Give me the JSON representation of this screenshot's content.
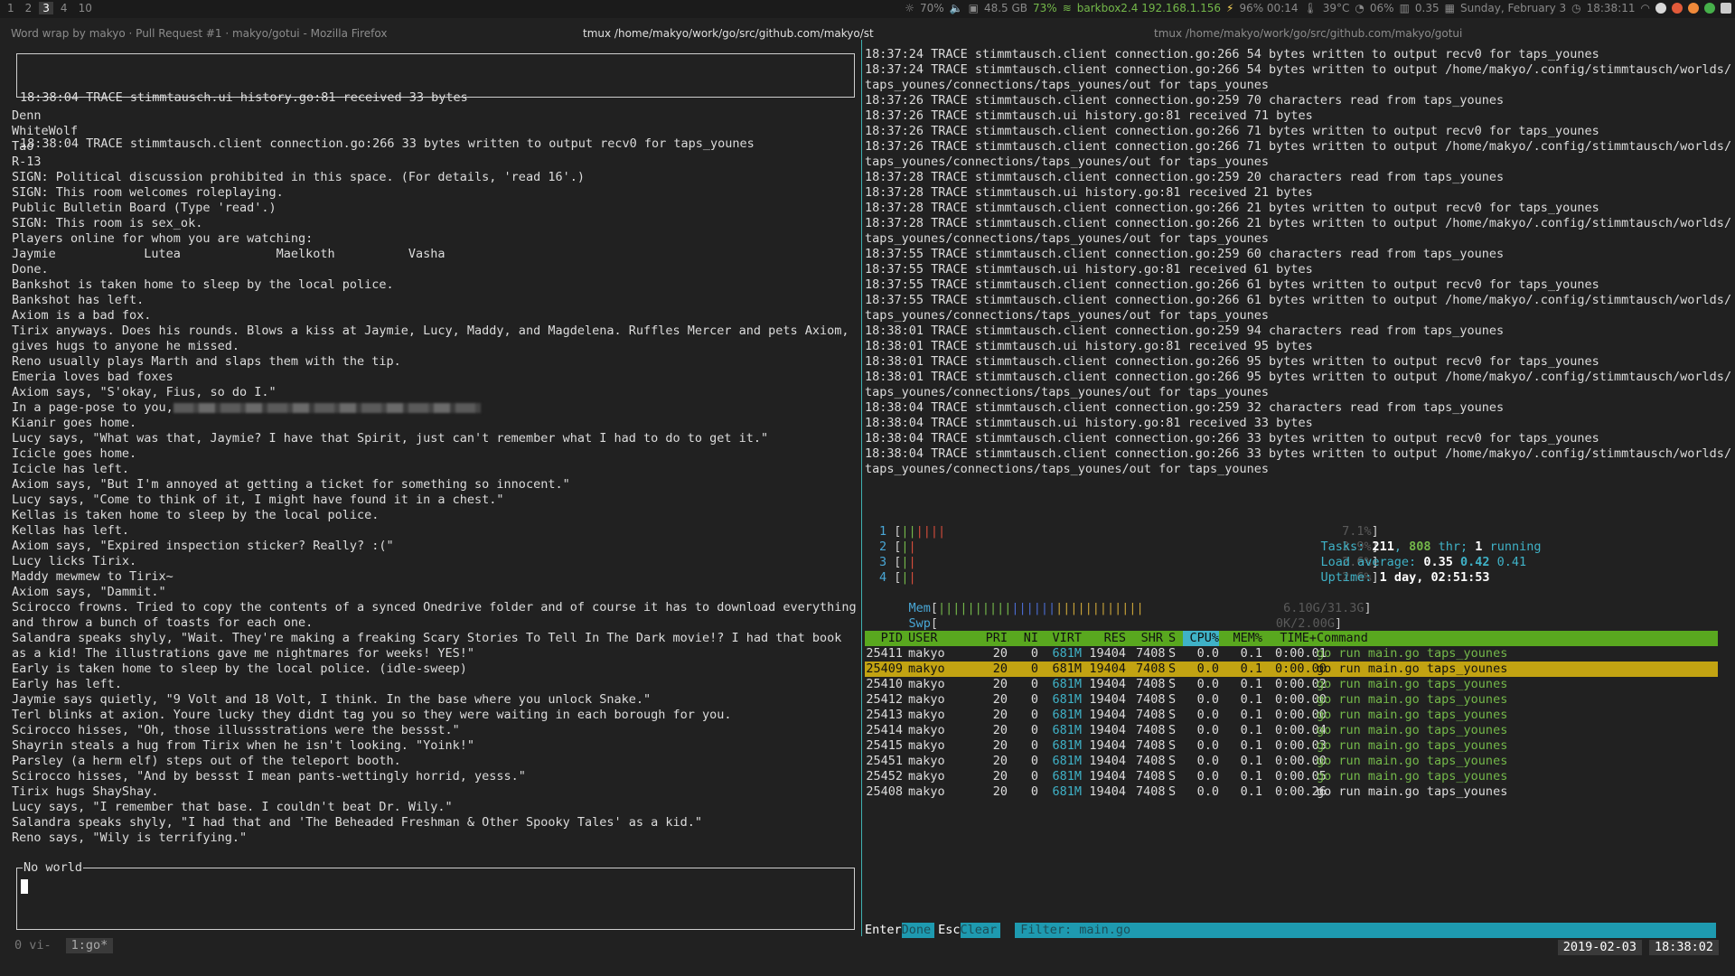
{
  "topbar": {
    "workspaces": [
      "1",
      "2",
      "3",
      "4",
      "10"
    ],
    "active_workspace": "3",
    "status": {
      "volume": "70%",
      "disk": "48.5 GB",
      "wifi_quality": "73%",
      "wifi_ssid": "barkbox2.4 192.168.1.156",
      "battery": "96% 00:14",
      "temp": "39°C",
      "cpu": "06%",
      "load": "0.35",
      "date": "Sunday, February  3",
      "time": "18:38:11"
    }
  },
  "titles": {
    "firefox": "Word wrap by makyo · Pull Request #1 · makyo/gotui - Mozilla Firefox",
    "center": "tmux  /home/makyo/work/go/src/github.com/makyo/st",
    "right": "tmux  /home/makyo/work/go/src/github.com/makyo/gotui"
  },
  "left": {
    "log_lines": [
      "18:38:04 TRACE stimmtausch.ui history.go:81 received 33 bytes",
      "18:38:04 TRACE stimmtausch.client connection.go:266 33 bytes written to output recv0 for taps_younes"
    ],
    "chat_lines": [
      "Denn",
      "WhiteWolf",
      "Tao",
      "R-13",
      "SIGN: Political discussion prohibited in this space. (For details, 'read 16'.)",
      "SIGN: This room welcomes roleplaying.",
      "Public Bulletin Board (Type 'read'.)",
      "SIGN: This room is sex_ok.",
      "Players online for whom you are watching:",
      "Jaymie            Lutea             Maelkoth          Vasha",
      "Done.",
      "Bankshot is taken home to sleep by the local police.",
      "Bankshot has left.",
      "Axiom is a bad fox.",
      "Tirix anyways. Does his rounds. Blows a kiss at Jaymie, Lucy, Maddy, and Magdelena. Ruffles Mercer and pets Axiom,",
      "gives hugs to anyone he missed.",
      "Reno usually plays Marth and slaps them with the tip.",
      "Emeria loves bad foxes",
      "Axiom says, \"S'okay, Fius, so do I.\"",
      "In a page-pose to you,",
      "Kianir goes home.",
      "Lucy says, \"What was that, Jaymie? I have that Spirit, just can't remember what I had to do to get it.\"",
      "Icicle goes home.",
      "Icicle has left.",
      "Axiom says, \"But I'm annoyed at getting a ticket for something so innocent.\"",
      "Lucy says, \"Come to think of it, I might have found it in a chest.\"",
      "Kellas is taken home to sleep by the local police.",
      "Kellas has left.",
      "Axiom says, \"Expired inspection sticker? Really? :(\"",
      "Lucy licks Tirix.",
      "Maddy mewmew to Tirix~",
      "Axiom says, \"Dammit.\"",
      "Scirocco frowns. Tried to copy the contents of a synced Onedrive folder and of course it has to download everything",
      "and throw a bunch of toasts for each one.",
      "Salandra speaks shyly, \"Wait. They're making a freaking Scary Stories To Tell In The Dark movie!? I had that book",
      "as a kid! The illustrations gave me nightmares for weeks! YES!\"",
      "Early is taken home to sleep by the local police. (idle-sweep)",
      "Early has left.",
      "Jaymie says quietly, \"9 Volt and 18 Volt, I think. In the base where you unlock Snake.\"",
      "Terl blinks at axion. Youre lucky they didnt tag you so they were waiting in each borough for you.",
      "Scirocco hisses, \"Oh, those illussstrations were the bessst.\"",
      "Shayrin steals a hug from Tirix when he isn't looking. \"Yoink!\"",
      "Parsley (a herm elf) steps out of the teleport booth.",
      "Scirocco hisses, \"And by bessst I mean pants-wettingly horrid, yesss.\"",
      "Tirix hugs ShayShay.",
      "Lucy says, \"I remember that base. I couldn't beat Dr. Wily.\"",
      "Salandra speaks shyly, \"I had that and 'The Beheaded Freshman & Other Spooky Tales' as a kid.\"",
      "Reno says, \"Wily is terrifying.\""
    ],
    "input_label": "No world",
    "tmux": {
      "win0": "0 vi-",
      "win1": "1:go*"
    }
  },
  "right": {
    "log_lines": [
      "18:37:24 TRACE stimmtausch.client connection.go:266 54 bytes written to output recv0 for taps_younes",
      "18:37:24 TRACE stimmtausch.client connection.go:266 54 bytes written to output /home/makyo/.config/stimmtausch/worlds/",
      "taps_younes/connections/taps_younes/out for taps_younes",
      "18:37:26 TRACE stimmtausch.client connection.go:259 70 characters read from taps_younes",
      "18:37:26 TRACE stimmtausch.ui history.go:81 received 71 bytes",
      "18:37:26 TRACE stimmtausch.client connection.go:266 71 bytes written to output recv0 for taps_younes",
      "18:37:26 TRACE stimmtausch.client connection.go:266 71 bytes written to output /home/makyo/.config/stimmtausch/worlds/",
      "taps_younes/connections/taps_younes/out for taps_younes",
      "18:37:28 TRACE stimmtausch.client connection.go:259 20 characters read from taps_younes",
      "18:37:28 TRACE stimmtausch.ui history.go:81 received 21 bytes",
      "18:37:28 TRACE stimmtausch.client connection.go:266 21 bytes written to output recv0 for taps_younes",
      "18:37:28 TRACE stimmtausch.client connection.go:266 21 bytes written to output /home/makyo/.config/stimmtausch/worlds/",
      "taps_younes/connections/taps_younes/out for taps_younes",
      "18:37:55 TRACE stimmtausch.client connection.go:259 60 characters read from taps_younes",
      "18:37:55 TRACE stimmtausch.ui history.go:81 received 61 bytes",
      "18:37:55 TRACE stimmtausch.client connection.go:266 61 bytes written to output recv0 for taps_younes",
      "18:37:55 TRACE stimmtausch.client connection.go:266 61 bytes written to output /home/makyo/.config/stimmtausch/worlds/",
      "taps_younes/connections/taps_younes/out for taps_younes",
      "18:38:01 TRACE stimmtausch.client connection.go:259 94 characters read from taps_younes",
      "18:38:01 TRACE stimmtausch.ui history.go:81 received 95 bytes",
      "18:38:01 TRACE stimmtausch.client connection.go:266 95 bytes written to output recv0 for taps_younes",
      "18:38:01 TRACE stimmtausch.client connection.go:266 95 bytes written to output /home/makyo/.config/stimmtausch/worlds/",
      "taps_younes/connections/taps_younes/out for taps_younes",
      "18:38:04 TRACE stimmtausch.client connection.go:259 32 characters read from taps_younes",
      "18:38:04 TRACE stimmtausch.ui history.go:81 received 33 bytes",
      "18:38:04 TRACE stimmtausch.client connection.go:266 33 bytes written to output recv0 for taps_younes",
      "18:38:04 TRACE stimmtausch.client connection.go:266 33 bytes written to output /home/makyo/.config/stimmtausch/worlds/",
      "taps_younes/connections/taps_younes/out for taps_younes"
    ]
  },
  "htop": {
    "cpus": [
      {
        "label": "1",
        "value": "7.1%"
      },
      {
        "label": "2",
        "value": "3.9%"
      },
      {
        "label": "3",
        "value": "2.6%"
      },
      {
        "label": "4",
        "value": "2.6%"
      }
    ],
    "mem": {
      "label": "Mem",
      "value": "6.10G/31.3G"
    },
    "swp": {
      "label": "Swp",
      "value": "0K/2.00G"
    },
    "tasks": {
      "label": "Tasks:",
      "procs": "211",
      "threads": "808",
      "thr_label": "thr;",
      "running": "1",
      "running_label": "running"
    },
    "load": {
      "label": "Load average:",
      "l1": "0.35",
      "l5": "0.42",
      "l15": "0.41"
    },
    "uptime": {
      "label": "Uptime:",
      "value": "1 day, 02:51:53"
    },
    "columns": [
      "PID",
      "USER",
      "PRI",
      "NI",
      "VIRT",
      "RES",
      "SHR",
      "S",
      "CPU%",
      "MEM%",
      "TIME+",
      "Command"
    ],
    "sorted_column": "CPU%",
    "processes": [
      {
        "pid": "25411",
        "user": "makyo",
        "pri": "20",
        "ni": "0",
        "virt": "681M",
        "res": "19404",
        "shr": "7408",
        "s": "S",
        "cpu": "0.0",
        "mem": "0.1",
        "time": "0:00.01",
        "cmd": "go run main.go taps_younes"
      },
      {
        "pid": "25409",
        "user": "makyo",
        "pri": "20",
        "ni": "0",
        "virt": "681M",
        "res": "19404",
        "shr": "7408",
        "s": "S",
        "cpu": "0.0",
        "mem": "0.1",
        "time": "0:00.00",
        "cmd": "go run main.go taps_younes"
      },
      {
        "pid": "25410",
        "user": "makyo",
        "pri": "20",
        "ni": "0",
        "virt": "681M",
        "res": "19404",
        "shr": "7408",
        "s": "S",
        "cpu": "0.0",
        "mem": "0.1",
        "time": "0:00.02",
        "cmd": "go run main.go taps_younes"
      },
      {
        "pid": "25412",
        "user": "makyo",
        "pri": "20",
        "ni": "0",
        "virt": "681M",
        "res": "19404",
        "shr": "7408",
        "s": "S",
        "cpu": "0.0",
        "mem": "0.1",
        "time": "0:00.00",
        "cmd": "go run main.go taps_younes"
      },
      {
        "pid": "25413",
        "user": "makyo",
        "pri": "20",
        "ni": "0",
        "virt": "681M",
        "res": "19404",
        "shr": "7408",
        "s": "S",
        "cpu": "0.0",
        "mem": "0.1",
        "time": "0:00.00",
        "cmd": "go run main.go taps_younes"
      },
      {
        "pid": "25414",
        "user": "makyo",
        "pri": "20",
        "ni": "0",
        "virt": "681M",
        "res": "19404",
        "shr": "7408",
        "s": "S",
        "cpu": "0.0",
        "mem": "0.1",
        "time": "0:00.04",
        "cmd": "go run main.go taps_younes"
      },
      {
        "pid": "25415",
        "user": "makyo",
        "pri": "20",
        "ni": "0",
        "virt": "681M",
        "res": "19404",
        "shr": "7408",
        "s": "S",
        "cpu": "0.0",
        "mem": "0.1",
        "time": "0:00.03",
        "cmd": "go run main.go taps_younes"
      },
      {
        "pid": "25451",
        "user": "makyo",
        "pri": "20",
        "ni": "0",
        "virt": "681M",
        "res": "19404",
        "shr": "7408",
        "s": "S",
        "cpu": "0.0",
        "mem": "0.1",
        "time": "0:00.00",
        "cmd": "go run main.go taps_younes"
      },
      {
        "pid": "25452",
        "user": "makyo",
        "pri": "20",
        "ni": "0",
        "virt": "681M",
        "res": "19404",
        "shr": "7408",
        "s": "S",
        "cpu": "0.0",
        "mem": "0.1",
        "time": "0:00.05",
        "cmd": "go run main.go taps_younes"
      },
      {
        "pid": "25408",
        "user": "makyo",
        "pri": "20",
        "ni": "0",
        "virt": "681M",
        "res": "19404",
        "shr": "7408",
        "s": "S",
        "cpu": "0.0",
        "mem": "0.1",
        "time": "0:00.26",
        "cmd": "go run main.go taps_younes"
      }
    ],
    "selected_pid": "25409",
    "filterbar": {
      "enter_key": "Enter",
      "enter_action": "Done",
      "esc_key": "Esc",
      "esc_action": "Clear",
      "filter_text": "Filter: main.go"
    }
  },
  "tmux_right": {
    "date": "2019-02-03",
    "time": "18:38:02"
  }
}
